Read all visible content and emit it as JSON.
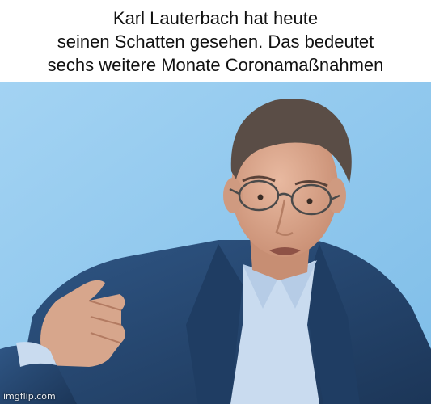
{
  "caption": {
    "line1": "Karl Lauterbach hat heute",
    "line2": "seinen Schatten gesehen. Das bedeutet",
    "line3": "sechs weitere Monate Coronamaßnahmen"
  },
  "watermark": "imgflip.com",
  "colors": {
    "background": "#8ec8ee",
    "jacket": "#25456e",
    "shirt": "#c9dbef",
    "skin": "#d9a890",
    "hair": "#5a4d46"
  }
}
